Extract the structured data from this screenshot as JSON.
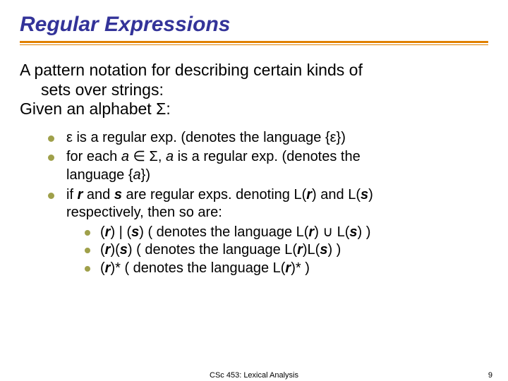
{
  "title": "Regular Expressions",
  "intro": {
    "line1": "A pattern notation for describing certain kinds of",
    "line2": "sets over strings:",
    "line3_a": "Given an alphabet ",
    "line3_sigma": "Σ",
    "line3_b": ":"
  },
  "b1": {
    "eps": "ε",
    "a": " is a regular exp.  (denotes the language {",
    "eps2": "ε",
    "b": "})"
  },
  "b2": {
    "a": "for each ",
    "avar": "a",
    "b": " ∈ ",
    "sigma": "Σ",
    "c": ", ",
    "avar2": "a",
    "d": " is a regular exp. (denotes the",
    "e": "language {",
    "avar3": "a",
    "f": "})"
  },
  "b3": {
    "a": "if ",
    "r": "r",
    "b": " and ",
    "s": "s",
    "c": " are regular exps. denoting L(",
    "r2": "r",
    "d": ") and L(",
    "s2": "s",
    "e": ")",
    "f": "respectively, then so are:"
  },
  "s1": {
    "a": "(",
    "r": "r",
    "b": ") | (",
    "s": "s",
    "c": ")  ( denotes the language L(",
    "r2": "r",
    "d": ") ∪ L(",
    "s2": "s",
    "e": ") )"
  },
  "s2": {
    "a": "(",
    "r": "r",
    "b": ")(",
    "s": "s",
    "c": ")  ( denotes the language L(",
    "r2": "r",
    "d": ")L(",
    "s2": "s",
    "e": ") )"
  },
  "s3": {
    "a": "(",
    "r": "r",
    "b": ")* ( denotes the language L(",
    "r2": "r",
    "c": ")* )"
  },
  "footer": {
    "center": "CSc 453: Lexical Analysis",
    "page": "9"
  }
}
